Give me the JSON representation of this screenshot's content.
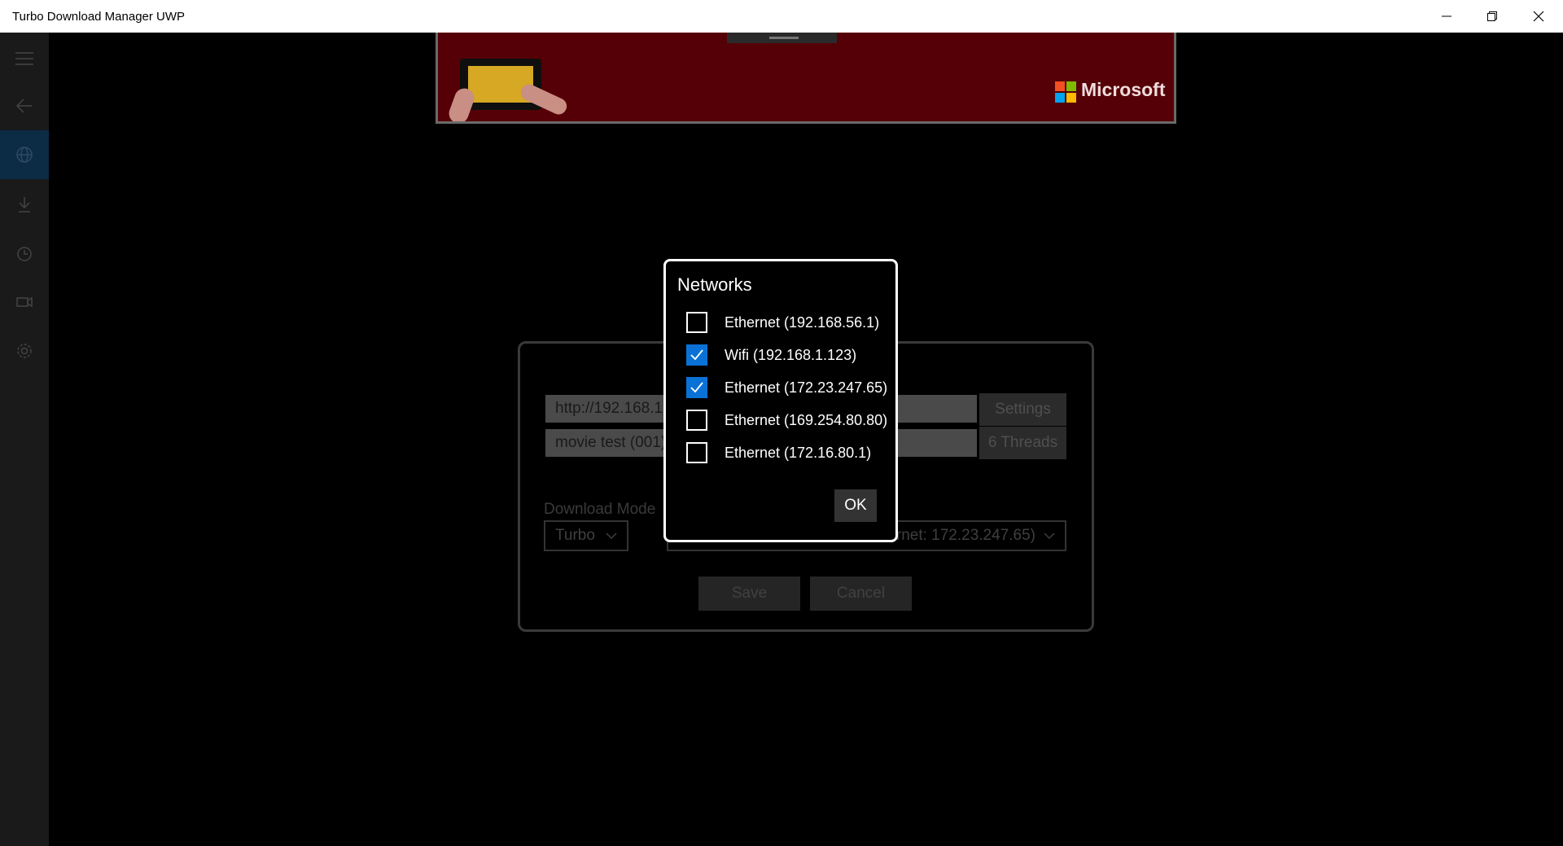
{
  "window": {
    "title": "Turbo Download Manager UWP"
  },
  "sidebar": {
    "items": [
      {
        "icon": "hamburger-menu-icon"
      },
      {
        "icon": "back-arrow-icon"
      },
      {
        "icon": "globe-icon",
        "active": true
      },
      {
        "icon": "download-icon"
      },
      {
        "icon": "clock-icon"
      },
      {
        "icon": "video-camera-icon"
      },
      {
        "icon": "gear-icon"
      }
    ]
  },
  "ad": {
    "brand": "Microsoft"
  },
  "settings_panel": {
    "url_value": "http://192.168.1",
    "filename_value": "movie test (001)",
    "settings_label": "Settings",
    "threads_label": "6 Threads",
    "download_mode_label": "Download Mode",
    "download_mode_value": "Turbo",
    "network_value": "ernet: 172.23.247.65)",
    "save_label": "Save",
    "cancel_label": "Cancel"
  },
  "networks_dialog": {
    "title": "Networks",
    "items": [
      {
        "label": "Ethernet (192.168.56.1)",
        "checked": false
      },
      {
        "label": "Wifi (192.168.1.123)",
        "checked": true
      },
      {
        "label": "Ethernet (172.23.247.65)",
        "checked": true
      },
      {
        "label": "Ethernet (169.254.80.80)",
        "checked": false
      },
      {
        "label": "Ethernet (172.16.80.1)",
        "checked": false
      }
    ],
    "ok_label": "OK"
  },
  "colors": {
    "accent": "#0a72d6",
    "sidebar_active": "#0c2c46",
    "ad_background": "#550006"
  }
}
